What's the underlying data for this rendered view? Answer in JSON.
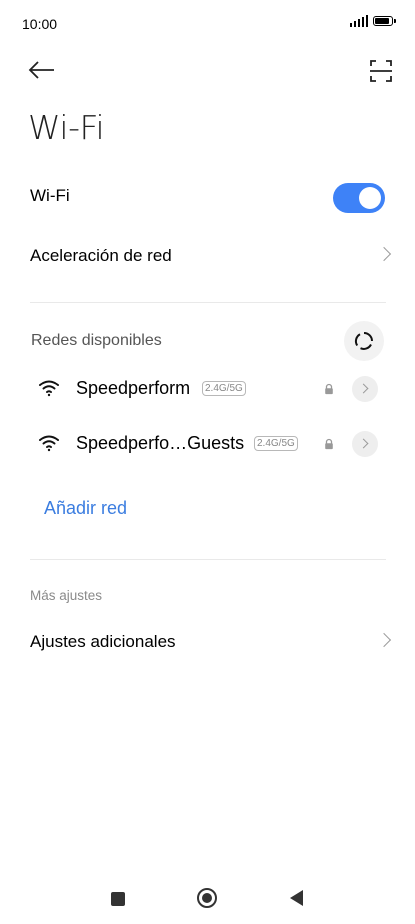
{
  "status_bar": {
    "time": "10:00"
  },
  "header": {
    "title": "Wi-Fi",
    "back_icon": "arrow-left-icon",
    "scan_icon": "qr-scan-icon"
  },
  "wifi_toggle": {
    "label": "Wi-Fi",
    "enabled": true,
    "accent_color": "#3e82f7"
  },
  "network_acceleration": {
    "label": "Aceleración de red"
  },
  "available_networks": {
    "header": "Redes disponibles",
    "refresh_icon": "refresh-icon",
    "items": [
      {
        "ssid": "Speedperform",
        "band": "2.4G/5G",
        "secured": true
      },
      {
        "ssid": "Speedperfo…Guests",
        "band": "2.4G/5G",
        "secured": true
      }
    ]
  },
  "add_network": {
    "label": "Añadir red"
  },
  "more_settings": {
    "header": "Más ajustes",
    "extra_label": "Ajustes adicionales"
  }
}
